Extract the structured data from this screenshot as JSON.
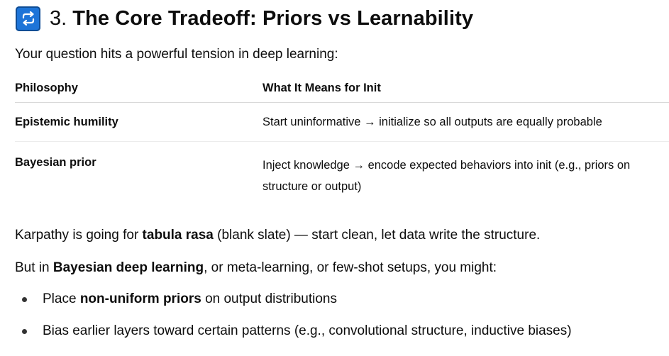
{
  "heading": {
    "icon": "repeat-arrows-icon",
    "icon_color": "#1d74d8",
    "number": "3.",
    "title": "The Core Tradeoff: Priors vs Learnability"
  },
  "intro": "Your question hits a powerful tension in deep learning:",
  "table": {
    "headers": [
      "Philosophy",
      "What It Means for Init"
    ],
    "rows": [
      {
        "philosophy": "Epistemic humility",
        "meaning": "Start uninformative → initialize so all outputs are equally probable"
      },
      {
        "philosophy": "Bayesian prior",
        "meaning": "Inject knowledge → encode expected behaviors into init (e.g., priors on structure or output)"
      }
    ]
  },
  "para1": {
    "before": "Karpathy is going for ",
    "bold": "tabula rasa",
    "after": " (blank slate) — start clean, let data write the structure."
  },
  "para2": {
    "before": "But in ",
    "bold": "Bayesian deep learning",
    "after": ", or meta-learning, or few-shot setups, you might:"
  },
  "bullets": [
    {
      "before": "Place ",
      "bold": "non-uniform priors",
      "after": " on output distributions"
    },
    {
      "before": "Bias earlier layers toward certain patterns (e.g., convolutional structure, inductive biases)",
      "bold": "",
      "after": ""
    }
  ]
}
